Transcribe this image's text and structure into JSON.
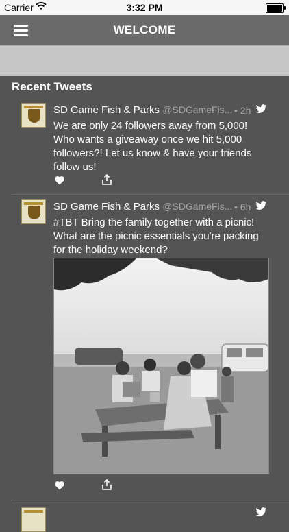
{
  "status_bar": {
    "carrier": "Carrier",
    "time": "3:32 PM"
  },
  "nav": {
    "title": "WELCOME"
  },
  "section": {
    "title": "Recent Tweets"
  },
  "tweets": [
    {
      "name": "SD Game Fish & Parks",
      "handle": "@SDGameFis...",
      "time": "• 2h",
      "text": "We are only 24 followers away from 5,000! Who wants a giveaway once we hit 5,000 followers?! Let us know & have your friends follow us!"
    },
    {
      "name": "SD Game Fish & Parks",
      "handle": "@SDGameFis...",
      "time": "• 6h",
      "text": "#TBT Bring the family together with a picnic! What are the picnic essentials you're packing for the holiday weekend?"
    }
  ],
  "icons": {
    "wifi": "wifi-icon",
    "battery": "battery-icon",
    "menu": "hamburger-menu-icon",
    "twitter": "twitter-bird-icon",
    "like": "heart-icon",
    "share": "share-icon"
  },
  "colors": {
    "background": "#545454",
    "navbar": "#6a6a6a",
    "subbar": "#c6c6c6",
    "twitter_blue": "#ffffff",
    "muted": "#a9a9a9"
  }
}
